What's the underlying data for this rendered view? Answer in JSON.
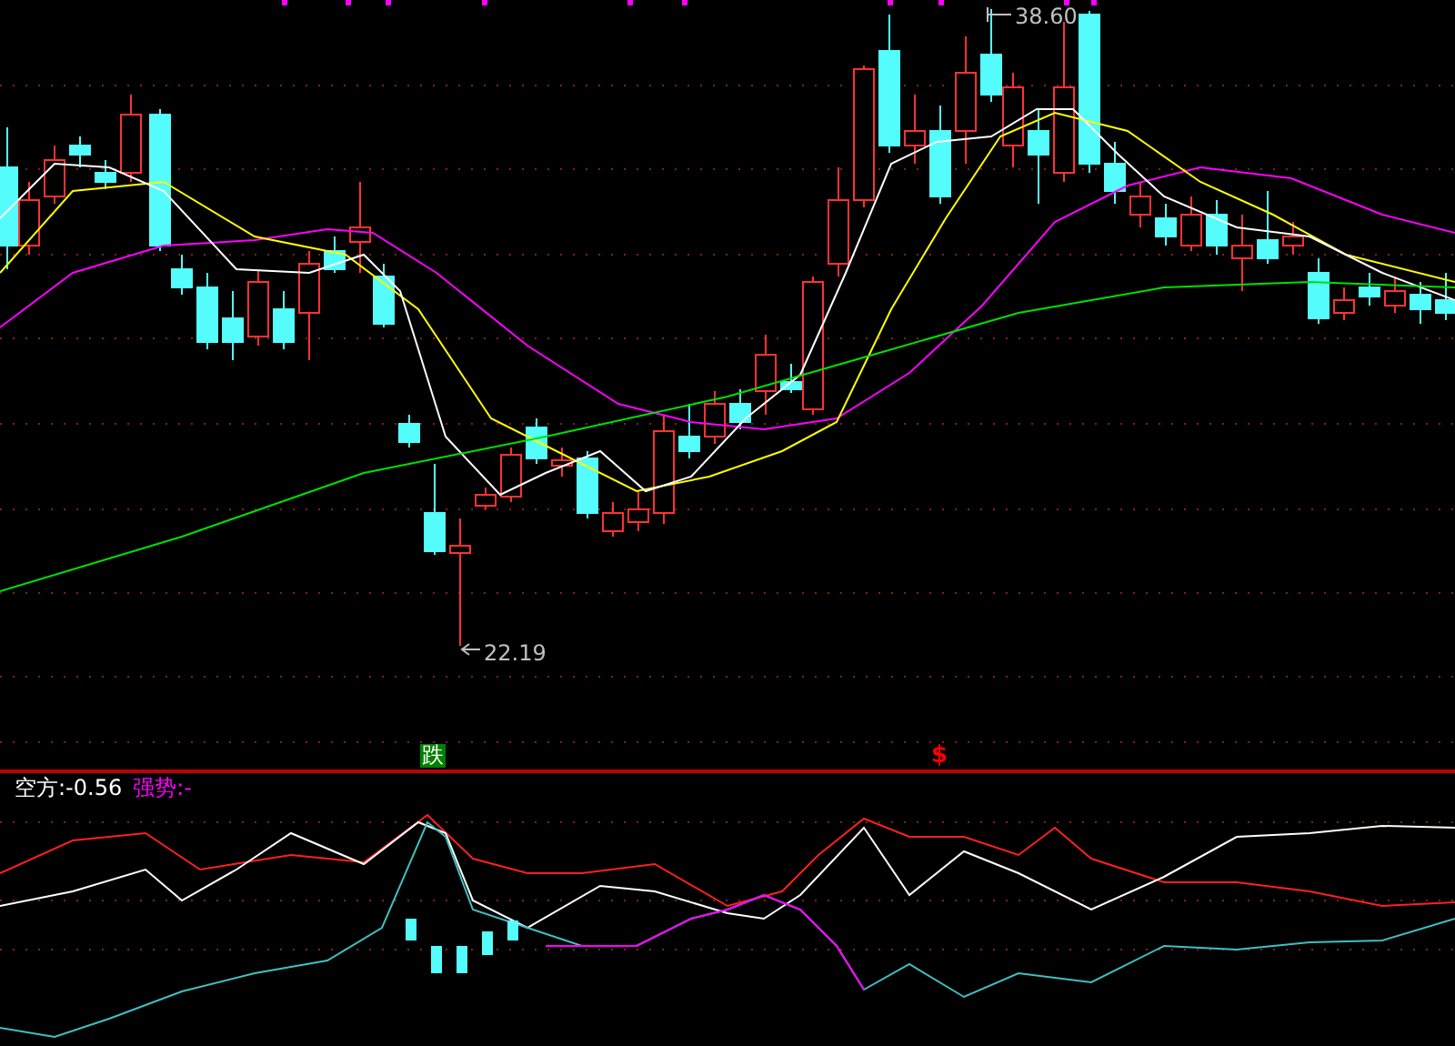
{
  "price_chart": {
    "high_label": "38.60",
    "low_label": "22.19",
    "signals": [
      {
        "kind": "fall",
        "text": "跌"
      },
      {
        "kind": "dollar",
        "text": "$"
      }
    ]
  },
  "indicator": {
    "legend": [
      {
        "label": "空方:-0.56",
        "color": "#ffffff"
      },
      {
        "label": "强势:-",
        "color": "#ff00ff"
      }
    ]
  }
}
